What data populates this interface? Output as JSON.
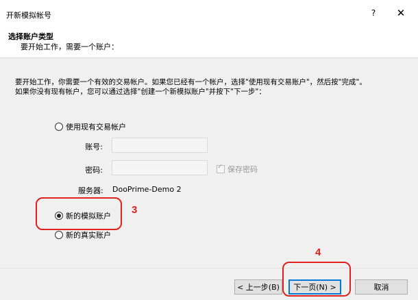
{
  "window": {
    "title": "开新模拟帐号",
    "help": "?",
    "close": "✕"
  },
  "header": {
    "section_title": "选择账户类型",
    "section_subtitle": "要开始工作，需要一个账户："
  },
  "content": {
    "intro_line1": "要开始工作，你需要一个有效的交易帐户。如果您已经有一个帐户，选择\"使用现有交易账户\"，然后按\"完成\"。",
    "intro_line2": "如果你没有现有帐户，您可以通过选择\"创建一个新模拟账户\"并按下\"下一步\"：",
    "options": {
      "existing_label": "使用现有交易帐户",
      "existing_checked": false,
      "demo_label": "新的模拟账户",
      "demo_checked": true,
      "real_label": "新的真实账户",
      "real_checked": false
    },
    "fields": {
      "login_label": "账号:",
      "login_value": "",
      "password_label": "密码:",
      "password_value": "",
      "save_password_label": "保存密码",
      "save_password_checked": true
    },
    "server": {
      "label": "服务器:",
      "value": "DooPrime-Demo 2"
    }
  },
  "footer": {
    "back_label": "< 上一步(B)",
    "next_label": "下一页(N) >",
    "cancel_label": "取消"
  },
  "annotations": {
    "step3": "3",
    "step4": "4",
    "color": "#e0201b"
  }
}
